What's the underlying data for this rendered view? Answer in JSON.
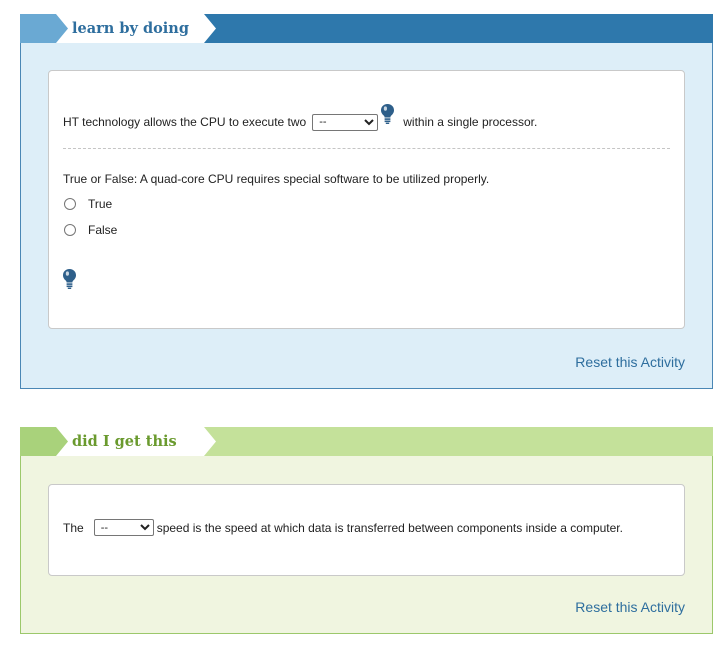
{
  "activity1": {
    "tab_label": "learn by doing",
    "question1": {
      "before": "HT technology allows the CPU to execute two",
      "select_value": "--",
      "after": "within a single processor."
    },
    "question2": {
      "prompt": "True or False: A quad-core CPU requires special software to be utilized properly.",
      "options": [
        "True",
        "False"
      ]
    },
    "reset_label": "Reset this Activity",
    "hint_icon": "lightbulb-icon"
  },
  "activity2": {
    "tab_label": "did I get this",
    "question": {
      "before": "The",
      "select_value": "--",
      "after": "speed is the speed at which data is transferred between components inside a computer."
    },
    "reset_label": "Reset this Activity"
  },
  "colors": {
    "blue_header": "#2e78ac",
    "blue_panel": "#ddeef8",
    "green_header": "#c4e19a",
    "green_panel": "#f0f5e0",
    "link": "#2e6e9e",
    "bulb": "#2e5f8a"
  }
}
